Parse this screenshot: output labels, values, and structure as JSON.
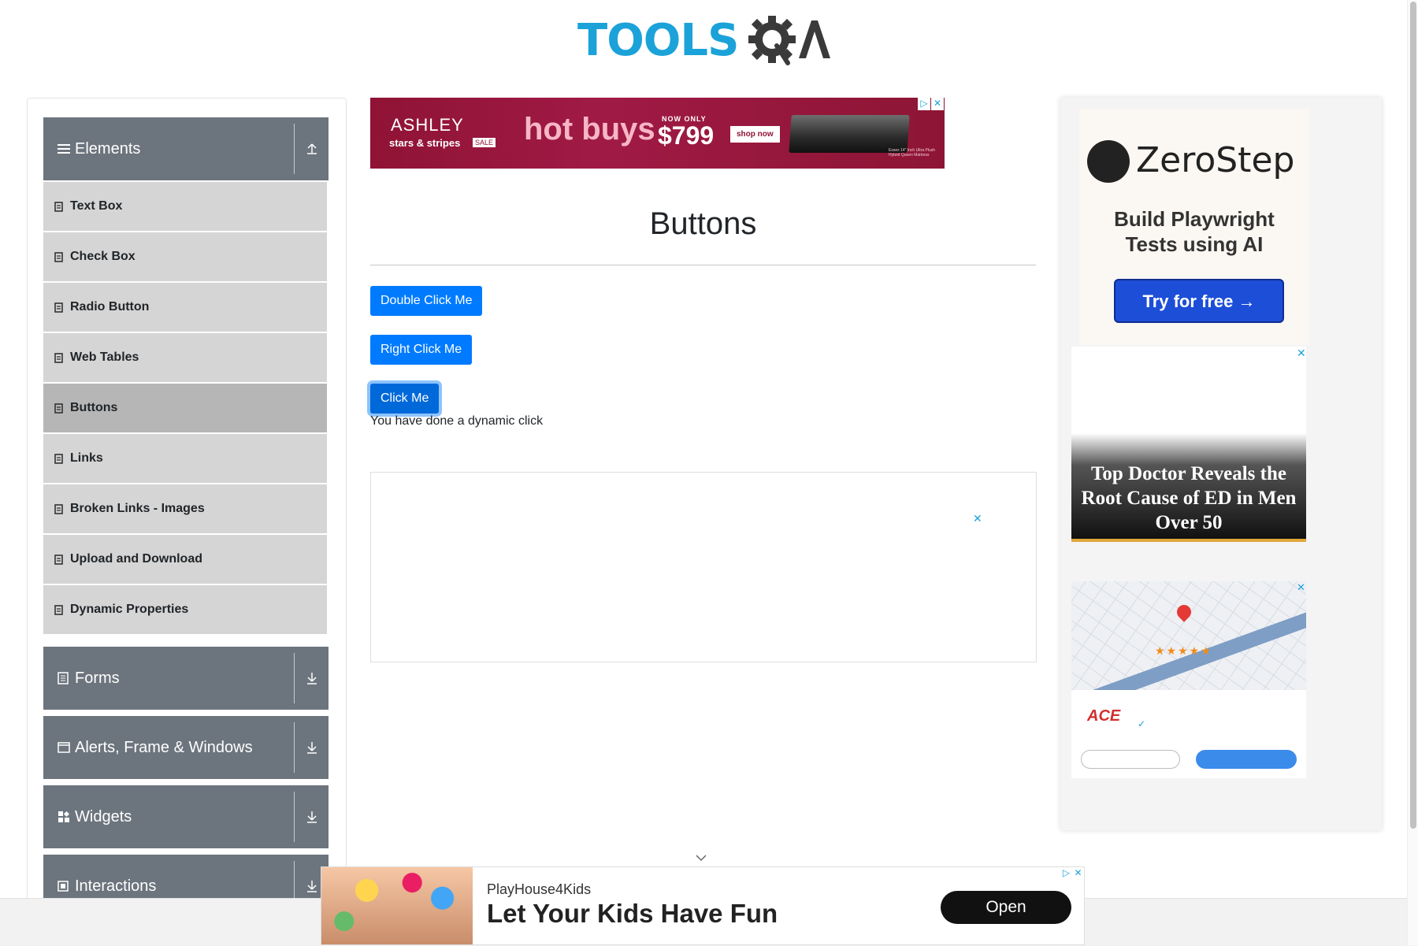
{
  "header": {
    "logo_text": "TOOLS",
    "logo_qa": "QA"
  },
  "sidebar": {
    "groups": [
      {
        "label": "Elements",
        "icon": "hamburger-icon",
        "toggle_icon": "collapse-up-icon"
      },
      {
        "label": "Forms",
        "icon": "form-icon",
        "toggle_icon": "expand-down-icon"
      },
      {
        "label": "Alerts, Frame & Windows",
        "icon": "window-icon",
        "toggle_icon": "expand-down-icon"
      },
      {
        "label": "Widgets",
        "icon": "widgets-icon",
        "toggle_icon": "expand-down-icon"
      },
      {
        "label": "Interactions",
        "icon": "interactions-icon",
        "toggle_icon": "expand-down-icon"
      }
    ],
    "items": [
      {
        "label": "Text Box"
      },
      {
        "label": "Check Box"
      },
      {
        "label": "Radio Button"
      },
      {
        "label": "Web Tables"
      },
      {
        "label": "Buttons",
        "active": true
      },
      {
        "label": "Links"
      },
      {
        "label": "Broken Links - Images"
      },
      {
        "label": "Upload and Download"
      },
      {
        "label": "Dynamic Properties"
      }
    ]
  },
  "top_ad": {
    "brand": "ASHLEY",
    "sub": "stars & stripes",
    "sale": "SALE",
    "headline": "hot buys",
    "now_only": "NOW ONLY",
    "price": "$799",
    "cta": "shop now",
    "fine_print": "Essex 14\" Inch Ultra Plush Hybrid Queen Mattress"
  },
  "main": {
    "title": "Buttons",
    "buttons": {
      "double_click": "Double Click Me",
      "right_click": "Right Click Me",
      "click": "Click Me"
    },
    "dynamic_message": "You have done a dynamic click"
  },
  "right_ads": {
    "zerostep": {
      "name": "ZeroStep",
      "tagline_1": "Build Playwright",
      "tagline_2": "Tests using AI",
      "cta": "Try for free →"
    },
    "doctor": {
      "line1": "Top Doctor Reveals the",
      "line2": "Root Cause of ED in Men",
      "line3": "Over 50"
    },
    "map": {
      "stars": "★★★★★",
      "brand": "ACE",
      "check": "✓"
    }
  },
  "bottom_ad": {
    "brand": "PlayHouse4Kids",
    "headline": "Let Your Kids Have Fun",
    "cta": "Open"
  },
  "colors": {
    "accent_blue": "#007bff",
    "sidebar_header": "#6c757d",
    "sidebar_item": "#d5d5d5",
    "sidebar_item_active": "#b6b6b6",
    "logo_blue": "#1ba2d9"
  }
}
